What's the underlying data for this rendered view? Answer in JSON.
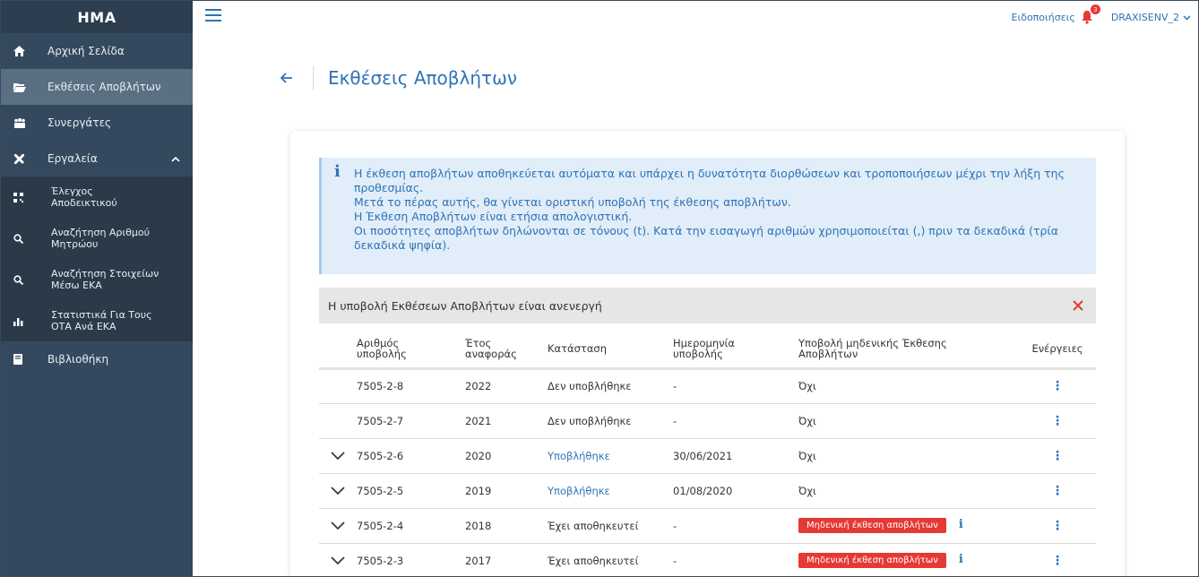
{
  "sidebar": {
    "brand": "HMA",
    "items": [
      {
        "label": "Αρχική Σελίδα",
        "icon": "home-icon"
      },
      {
        "label": "Εκθέσεις Αποβλήτων",
        "icon": "folder-open-icon"
      },
      {
        "label": "Συνεργάτες",
        "icon": "users-icon"
      },
      {
        "label": "Εργαλεία",
        "icon": "tools-icon"
      },
      {
        "label": "Βιβλιοθήκη",
        "icon": "book-icon"
      }
    ],
    "submenu": [
      {
        "label": "Έλεγχος Αποδεικτικού",
        "icon": "qrcode-icon"
      },
      {
        "label": "Αναζήτηση Αριθμού Μητρώου",
        "icon": "search-icon"
      },
      {
        "label": "Αναζήτηση Στοιχείων Μέσω ΕΚΑ",
        "icon": "search-icon"
      },
      {
        "label": "Στατιστικά Για Τους ΟΤΑ Ανά ΕΚΑ",
        "icon": "bar-chart-icon"
      }
    ]
  },
  "topbar": {
    "notifications_label": "Ειδοποιήσεις",
    "notifications_count": "3",
    "user": "DRAXISENV_2"
  },
  "page": {
    "title": "Εκθέσεις Αποβλήτων"
  },
  "info": {
    "lines": [
      "Η έκθεση αποβλήτων αποθηκεύεται αυτόματα και υπάρχει η δυνατότητα διορθώσεων και τροποποιήσεων μέχρι την λήξη της προθεσμίας.",
      "Μετά το πέρας αυτής, θα γίνεται οριστική υποβολή της έκθεσης αποβλήτων.",
      "Η Έκθεση Αποβλήτων είναι ετήσια απολογιστική.",
      "Οι ποσότητες αποβλήτων δηλώνονται σε τόνους (t). Κατά την εισαγωγή αριθμών χρησιμοποιείται (,) πριν τα δεκαδικά (τρία δεκαδικά ψηφία)."
    ]
  },
  "warning": {
    "text": "Η υποβολή Εκθέσεων Αποβλήτων είναι ανενεργή"
  },
  "table": {
    "headers": {
      "number": "Αριθμός υποβολής",
      "year": "Έτος αναφοράς",
      "state": "Κατάσταση",
      "date": "Ημερομηνία υποβολής",
      "zero": "Υποβολή μηδενικής Έκθεσης Αποβλήτων",
      "actions": "Ενέργειες"
    },
    "rows": [
      {
        "number": "7505-2-8",
        "year": "2022",
        "state": "Δεν υποβλήθηκε",
        "date": "-",
        "zero": "Όχι"
      },
      {
        "number": "7505-2-7",
        "year": "2021",
        "state": "Δεν υποβλήθηκε",
        "date": "-",
        "zero": "Όχι"
      },
      {
        "number": "7505-2-6",
        "year": "2020",
        "state": "Υποβλήθηκε",
        "date": "30/06/2021",
        "zero": "Όχι"
      },
      {
        "number": "7505-2-5",
        "year": "2019",
        "state": "Υποβλήθηκε",
        "date": "01/08/2020",
        "zero": "Όχι"
      },
      {
        "number": "7505-2-4",
        "year": "2018",
        "state": "Έχει αποθηκευτεί",
        "date": "-",
        "zero": "Μηδενική έκθεση αποβλήτων"
      },
      {
        "number": "7505-2-3",
        "year": "2017",
        "state": "Έχει αποθηκευτεί",
        "date": "-",
        "zero": "Μηδενική έκθεση αποβλήτων"
      }
    ]
  },
  "colors": {
    "sidebar_bg": "#34495e",
    "accent": "#2f73b5",
    "danger": "#e53935",
    "info_bg": "#e1edf9"
  }
}
